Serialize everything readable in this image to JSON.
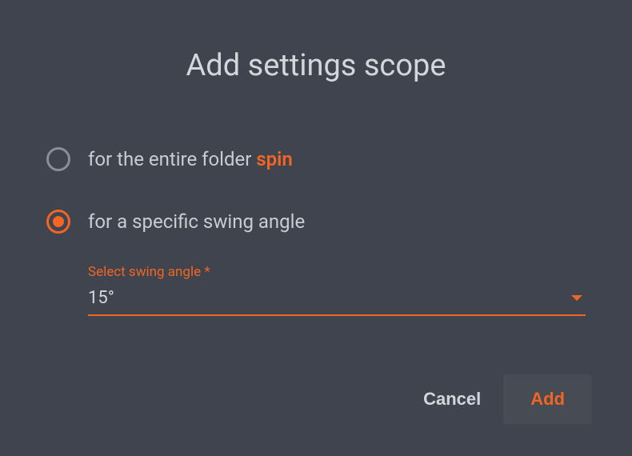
{
  "title": "Add settings scope",
  "options": {
    "entire_folder": {
      "label_prefix": "for the entire folder ",
      "folder_name": "spin",
      "selected": false
    },
    "specific_angle": {
      "label": "for a specific swing angle",
      "selected": true
    }
  },
  "select": {
    "label": "Select swing angle *",
    "value": "15°"
  },
  "actions": {
    "cancel": "Cancel",
    "add": "Add"
  },
  "colors": {
    "accent": "#f26522",
    "background": "#3f444e",
    "text": "#d4d6db"
  }
}
